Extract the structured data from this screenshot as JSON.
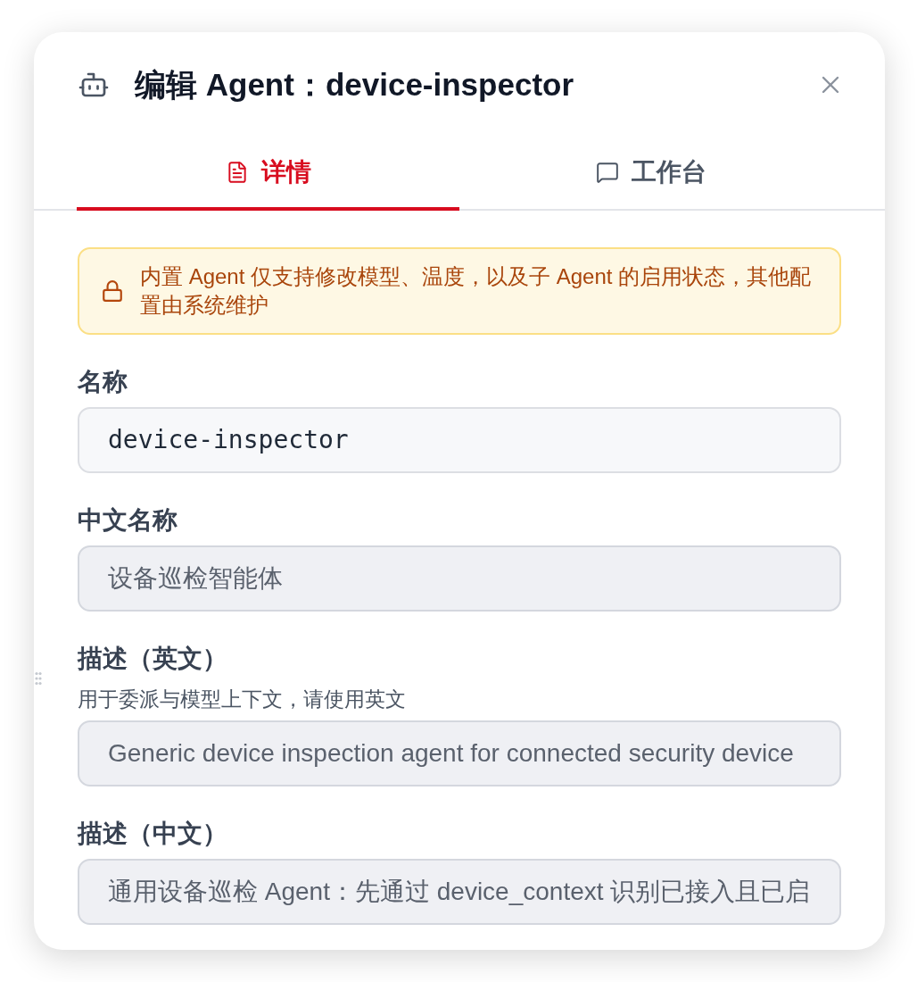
{
  "dialog": {
    "title": "编辑 Agent：device-inspector"
  },
  "tabs": [
    {
      "label": "详情",
      "selected": true
    },
    {
      "label": "工作台",
      "selected": false
    }
  ],
  "notice": {
    "text": "内置 Agent 仅支持修改模型、温度，以及子 Agent 的启用状态，其他配置由系统维护"
  },
  "fields": [
    {
      "label": "名称",
      "kind": "code",
      "disabled": false,
      "value": "device-inspector"
    },
    {
      "label": "中文名称",
      "kind": "text",
      "disabled": true,
      "value": "设备巡检智能体"
    },
    {
      "label": "描述（英文）",
      "hint": "用于委派与模型上下文，请使用英文",
      "kind": "text",
      "disabled": true,
      "value": "Generic device inspection agent for connected security device"
    },
    {
      "label": "描述（中文）",
      "kind": "text",
      "disabled": true,
      "value": "通用设备巡检 Agent：先通过 device_context 识别已接入且已启"
    }
  ]
}
